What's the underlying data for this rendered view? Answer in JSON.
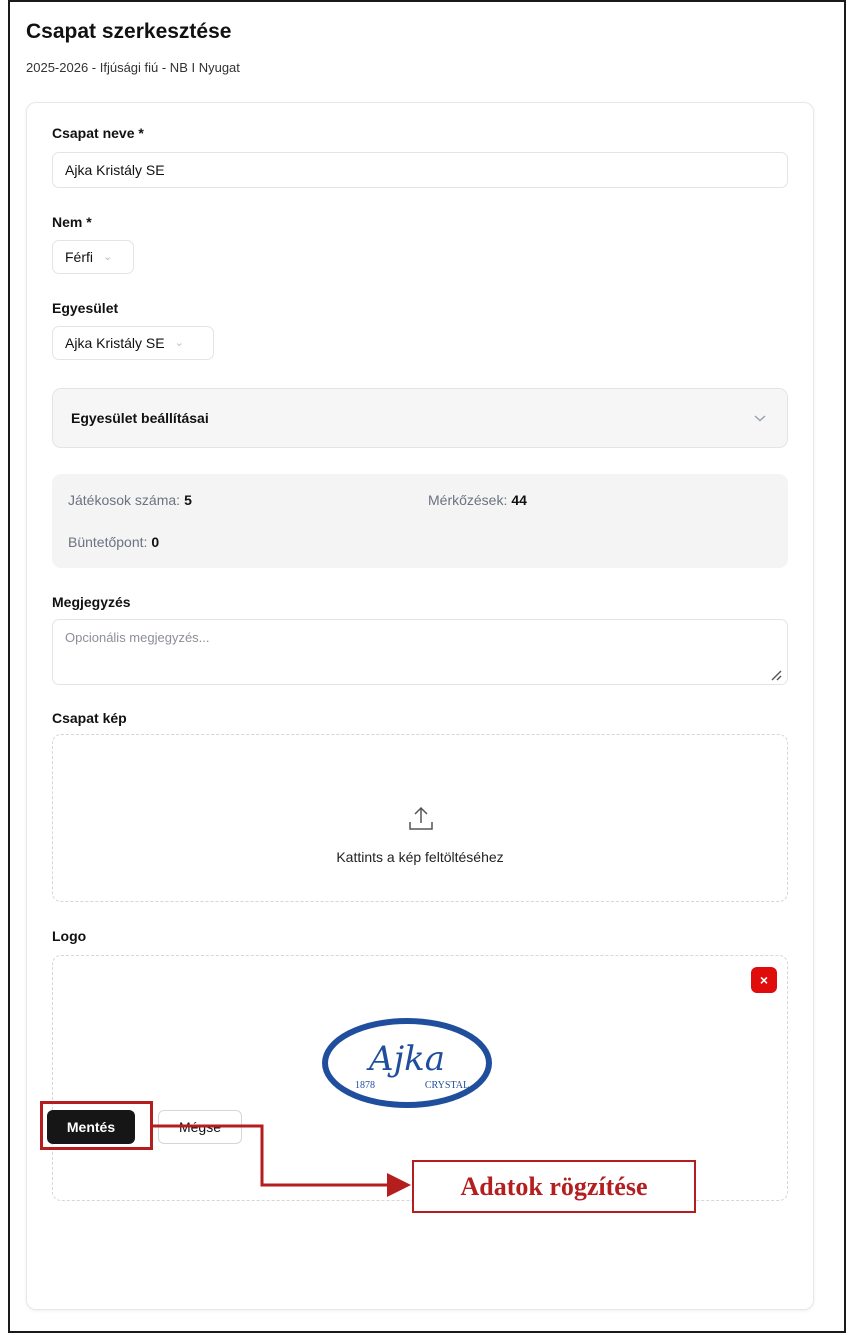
{
  "page": {
    "title": "Csapat szerkesztése",
    "subtitle": "2025-2026 - Ifjúsági fiú - NB I Nyugat"
  },
  "form": {
    "team_name": {
      "label": "Csapat neve *",
      "value": "Ajka Kristály SE"
    },
    "gender": {
      "label": "Nem *",
      "value": "Férfi"
    },
    "club": {
      "label": "Egyesület",
      "value": "Ajka Kristály SE"
    },
    "club_settings": {
      "label": "Egyesület beállításai"
    },
    "stats": {
      "players_label": "Játékosok száma:",
      "players_value": "5",
      "matches_label": "Mérkőzések:",
      "matches_value": "44",
      "penalty_label": "Büntetőpont:",
      "penalty_value": "0"
    },
    "note": {
      "label": "Megjegyzés",
      "placeholder": "Opcionális megjegyzés..."
    },
    "team_image": {
      "label": "Csapat kép",
      "upload_text": "Kattints a kép feltöltéséhez"
    },
    "logo": {
      "label": "Logo",
      "remove_symbol": "×",
      "image_text": {
        "script": "Ajka",
        "year": "1878",
        "brand": "CRYSTAL"
      }
    }
  },
  "actions": {
    "save": "Mentés",
    "cancel": "Mégse"
  },
  "annotation": {
    "callout": "Adatok rögzítése"
  },
  "colors": {
    "accent": "#b41e1e",
    "remove": "#e00b0b",
    "save_bg": "#161616",
    "logo_blue": "#1f4e9c"
  },
  "icons": {
    "dropdown": "chevron-down-icon",
    "upload": "upload-icon",
    "remove": "close-icon",
    "resize": "resize-handle-icon"
  }
}
